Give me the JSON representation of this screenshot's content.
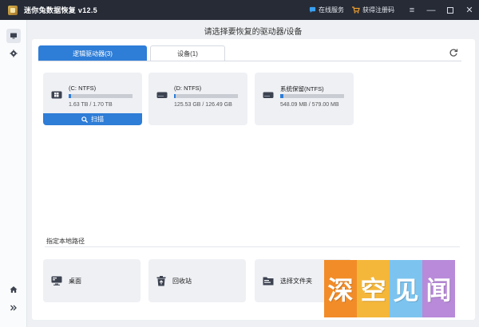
{
  "titlebar": {
    "title": "迷你兔数据恢复 v12.5",
    "online_service": "在线服务",
    "get_code": "获得注册码"
  },
  "main": {
    "header": "请选择要恢复的驱动器/设备",
    "tabs": [
      {
        "label": "逻辑驱动器(3)",
        "active": true
      },
      {
        "label": "设备(1)",
        "active": false
      }
    ],
    "drives": [
      {
        "name": "(C: NTFS)",
        "size": "1.63 TB / 1.70 TB",
        "used_fraction": 0.04
      },
      {
        "name": "(D: NTFS)",
        "size": "125.53 GB / 126.49 GB",
        "used_fraction": 0.02
      },
      {
        "name": "系统保留(NTFS)",
        "size": "548.09 MB / 579.00 MB",
        "used_fraction": 0.05
      }
    ],
    "scan_label": "扫描",
    "section_title": "指定本地路径",
    "locations": [
      {
        "label": "桌面",
        "icon": "desktop-icon"
      },
      {
        "label": "回收站",
        "icon": "recycle-bin-icon"
      },
      {
        "label": "选择文件夹",
        "icon": "folder-icon"
      }
    ]
  },
  "watermark": [
    "深",
    "空",
    "见",
    "闻"
  ],
  "colors": {
    "titlebar": "#262b36",
    "accent": "#2e7dd7",
    "card": "#eef0f4",
    "watermark": [
      "#f28c28",
      "#f5b73a",
      "#7cc4ef",
      "#b88ad9"
    ]
  }
}
